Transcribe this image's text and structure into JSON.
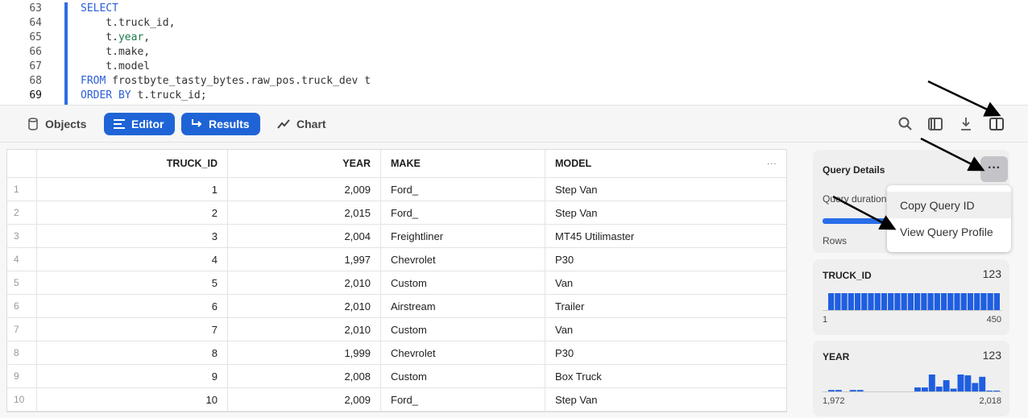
{
  "editor": {
    "lines": [
      {
        "n": "63",
        "parts": [
          {
            "t": "SELECT",
            "k": "kw"
          }
        ]
      },
      {
        "n": "64",
        "parts": [
          {
            "t": "    t.truck_id,",
            "k": ""
          }
        ]
      },
      {
        "n": "65",
        "parts": [
          {
            "t": "    t.",
            "k": ""
          },
          {
            "t": "year",
            "k": "fn"
          },
          {
            "t": ",",
            "k": ""
          }
        ]
      },
      {
        "n": "66",
        "parts": [
          {
            "t": "    t.make,",
            "k": ""
          }
        ]
      },
      {
        "n": "67",
        "parts": [
          {
            "t": "    t.model",
            "k": ""
          }
        ]
      },
      {
        "n": "68",
        "parts": [
          {
            "t": "FROM",
            "k": "kw"
          },
          {
            "t": " frostbyte_tasty_bytes.raw_pos.truck_dev t",
            "k": ""
          }
        ]
      },
      {
        "n": "69",
        "parts": [
          {
            "t": "ORDER BY",
            "k": "kw"
          },
          {
            "t": " t.truck_id;",
            "k": ""
          }
        ]
      }
    ]
  },
  "toolbar": {
    "objects": "Objects",
    "editor": "Editor",
    "results": "Results",
    "chart": "Chart",
    "accent": "#1f64d6"
  },
  "table": {
    "columns": [
      "TRUCK_ID",
      "YEAR",
      "MAKE",
      "MODEL"
    ],
    "more": "···",
    "rows": [
      [
        "1",
        "1",
        "2,009",
        "Ford_",
        "Step Van"
      ],
      [
        "2",
        "2",
        "2,015",
        "Ford_",
        "Step Van"
      ],
      [
        "3",
        "3",
        "2,004",
        "Freightliner",
        "MT45 Utilimaster"
      ],
      [
        "4",
        "4",
        "1,997",
        "Chevrolet",
        "P30"
      ],
      [
        "5",
        "5",
        "2,010",
        "Custom",
        "Van"
      ],
      [
        "6",
        "6",
        "2,010",
        "Airstream",
        "Trailer"
      ],
      [
        "7",
        "7",
        "2,010",
        "Custom",
        "Van"
      ],
      [
        "8",
        "8",
        "1,999",
        "Chevrolet",
        "P30"
      ],
      [
        "9",
        "9",
        "2,008",
        "Custom",
        "Box Truck"
      ],
      [
        "10",
        "10",
        "2,009",
        "Ford_",
        "Step Van"
      ]
    ]
  },
  "query_details": {
    "title": "Query Details",
    "duration_label": "Query duration",
    "rows_label": "Rows",
    "more": "···",
    "menu": [
      "Copy Query ID",
      "View Query Profile"
    ]
  },
  "columns_stats": [
    {
      "name": "TRUCK_ID",
      "type": "123",
      "min": "1",
      "max": "450",
      "hist": [
        1,
        1,
        1,
        1,
        1,
        1,
        1,
        1,
        1,
        1,
        1,
        1,
        1,
        1,
        1,
        1,
        1,
        1,
        1,
        1,
        1,
        1,
        1,
        1,
        1,
        1
      ]
    },
    {
      "name": "YEAR",
      "type": "123",
      "min": "1,972",
      "max": "2,018",
      "hist": [
        1.7,
        1.7,
        0,
        1.7,
        1.7,
        0,
        0,
        0,
        0,
        0,
        0,
        0,
        4.7,
        4.7,
        20,
        5.7,
        13.3,
        3.3,
        20,
        19,
        10,
        17.3,
        1,
        1
      ]
    }
  ],
  "bar_color": "#1f5ee0"
}
